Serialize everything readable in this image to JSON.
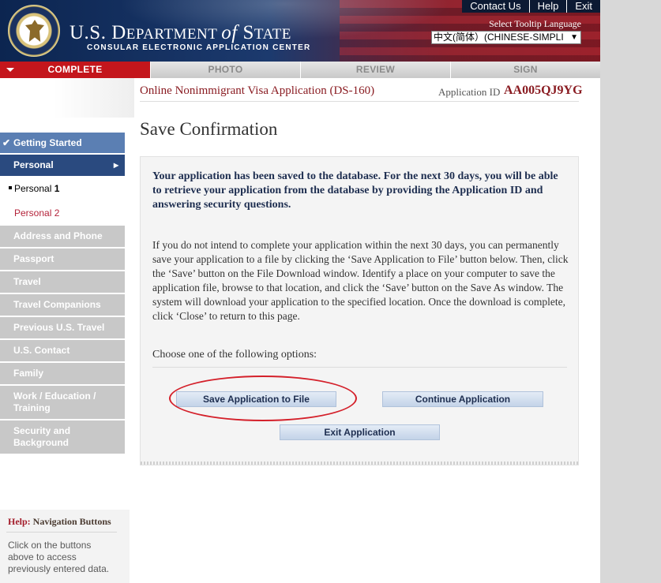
{
  "header": {
    "title_prefix": "U.S. D",
    "title_part1": "EPARTMENT ",
    "title_of": "of",
    "title_part2": " S",
    "title_part3": "TATE",
    "subtitle": "CONSULAR ELECTRONIC APPLICATION CENTER",
    "links": [
      "Contact Us",
      "Help",
      "Exit"
    ],
    "tooltip_language_label": "Select Tooltip Language",
    "tooltip_language_value": "中文(简体）(CHINESE-SIMPLI"
  },
  "progress": {
    "steps": [
      "COMPLETE",
      "PHOTO",
      "REVIEW",
      "SIGN"
    ],
    "active_index": 0
  },
  "nav": {
    "getting_started": "Getting Started",
    "personal": "Personal",
    "personal1": "Personal ",
    "personal1_num": "1",
    "personal2": "Personal 2",
    "disabled": [
      "Address and Phone",
      "Passport",
      "Travel",
      "Travel Companions",
      "Previous U.S. Travel",
      "U.S. Contact",
      "Family",
      "Work / Education / Training",
      "Security and Background"
    ]
  },
  "help": {
    "prefix": "Help:",
    "title": " Navigation Buttons",
    "text": "Click on the buttons above to access previously entered data."
  },
  "main": {
    "form_title": "Online Nonimmigrant Visa Application (DS-160)",
    "application_id_label": "Application ID",
    "application_id": "AA005QJ9YG",
    "heading": "Save Confirmation",
    "message_bold": "Your application has been saved to the database. For the next 30 days, you will be able to retrieve your application from the database by providing the Application ID and answering security questions.",
    "message_body": "If you do not intend to complete your application within the next 30 days, you can permanently save your application to a file by clicking the ‘Save Application to File’ button below. Then, click the ‘Save’ button on the File Download window. Identify a place on your computer to save the application file, browse to that location, and click the ‘Save’ button on the Save As window. The system will download your application to the specified location. Once the download is complete, click ‘Close’ to return to this page.",
    "choose_label": "Choose one of the following options:",
    "buttons": {
      "save": "Save Application to File",
      "continue": "Continue Application",
      "exit": "Exit Application"
    }
  },
  "colors": {
    "active_step": "#c4161c",
    "nav_current": "#2a4a7f",
    "nav_done": "#5b7fb3",
    "highlight_circle": "#d4202a"
  }
}
